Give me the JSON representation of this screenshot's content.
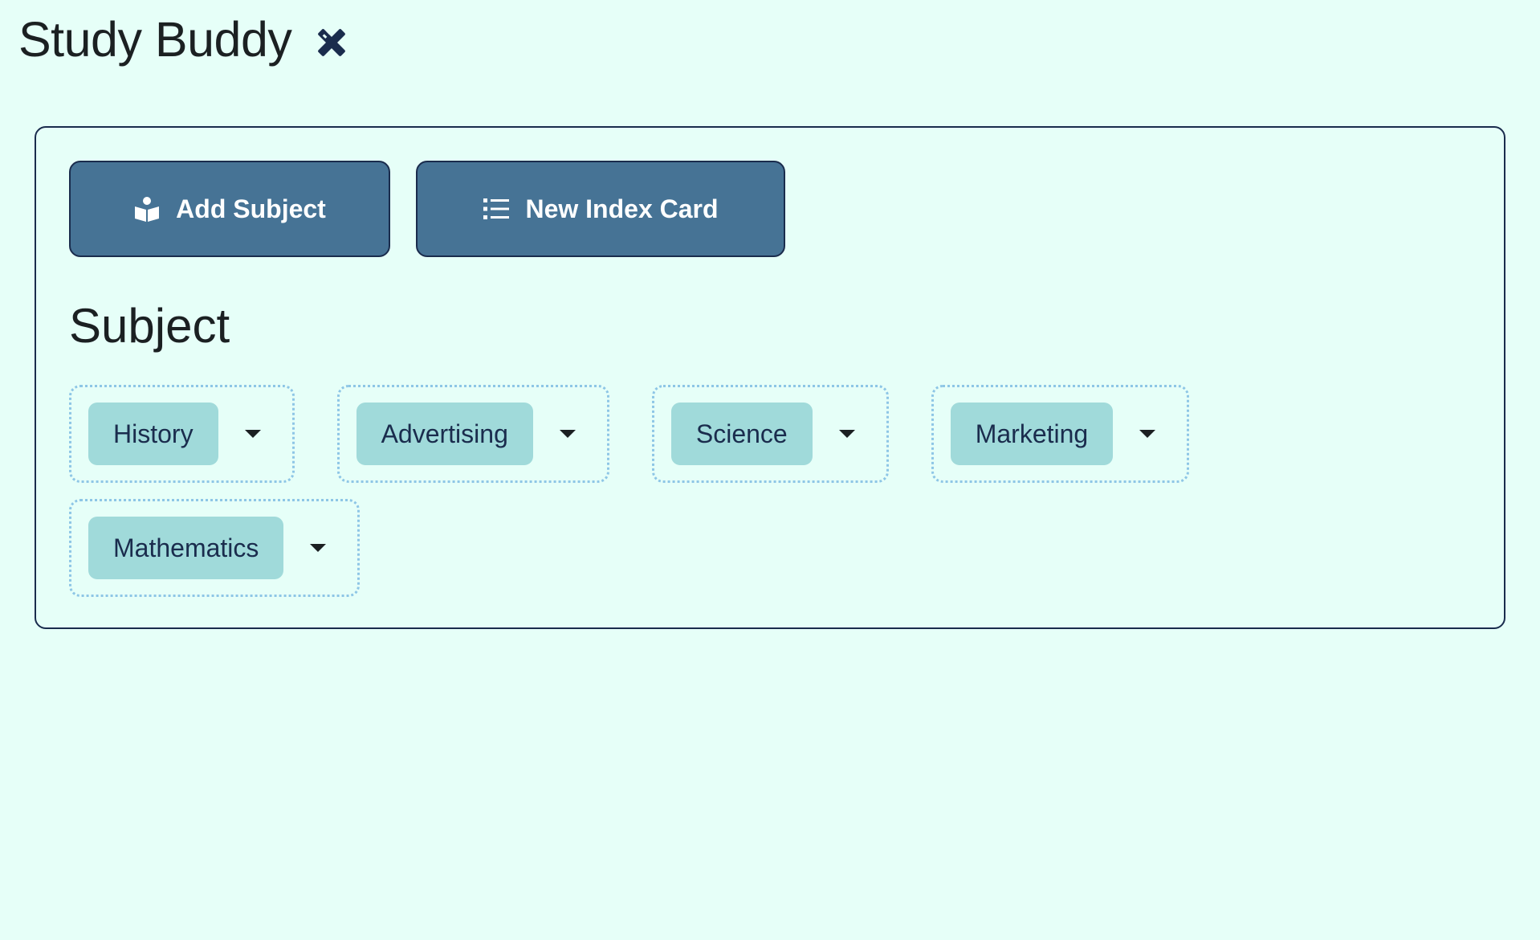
{
  "app": {
    "title": "Study Buddy",
    "title_icon": "pencil-ruler-icon"
  },
  "toolbar": {
    "add_subject": {
      "label": "Add Subject",
      "icon": "book-reader-icon"
    },
    "new_index_card": {
      "label": "New Index Card",
      "icon": "list-icon"
    }
  },
  "subjects": {
    "heading": "Subject",
    "items": [
      {
        "label": "History"
      },
      {
        "label": "Advertising"
      },
      {
        "label": "Science"
      },
      {
        "label": "Marketing"
      },
      {
        "label": "Mathematics"
      }
    ]
  },
  "colors": {
    "background": "#e6fff8",
    "button": "#467395",
    "chip": "#a0dada",
    "border": "#1a2c4d"
  }
}
